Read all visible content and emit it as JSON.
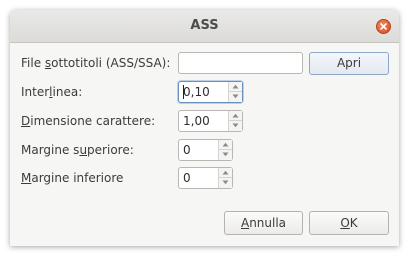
{
  "window": {
    "title": "ASS"
  },
  "form": {
    "file_label": {
      "pre": "File ",
      "mn": "s",
      "post": "ottotitoli (ASS/SSA):"
    },
    "file_value": "",
    "open_button": "Apri",
    "line_spacing_label": {
      "pre": "Inter",
      "mn": "l",
      "post": "inea:"
    },
    "line_spacing_value": "0,10",
    "font_size_label": {
      "pre": "",
      "mn": "D",
      "post": "imensione carattere:"
    },
    "font_size_value": "1,00",
    "top_margin_label": {
      "pre": "Margine s",
      "mn": "u",
      "post": "periore:"
    },
    "top_margin_value": "0",
    "bottom_margin_label": {
      "pre": "",
      "mn": "M",
      "post": "argine inferiore"
    },
    "bottom_margin_value": "0"
  },
  "buttons": {
    "cancel": {
      "pre": "",
      "mn": "A",
      "post": "nnulla"
    },
    "ok": {
      "pre": "",
      "mn": "O",
      "post": "K"
    }
  }
}
